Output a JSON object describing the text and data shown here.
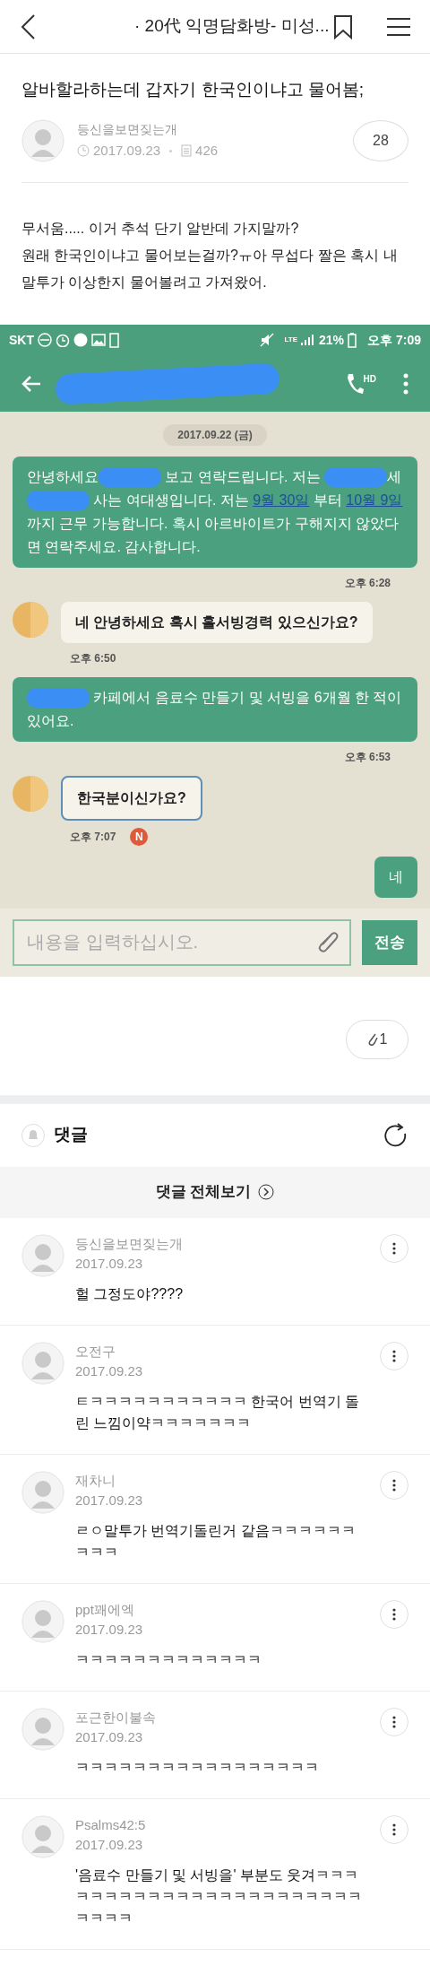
{
  "header": {
    "title": "· 20代 익명담화방- 미성..."
  },
  "post": {
    "title": "알바할라하는데 갑자기 한국인이냐고 물어봄;",
    "author": "등신을보면짖는개",
    "date": "2017.09.23",
    "views": "426",
    "comment_count": "28",
    "body": [
      "무서움..... 이거 추석 단기 알반데 가지말까?",
      "원래 한국인이냐고 물어보는걸까?ㅠ아 무섭다 짤은 혹시 내 말투가 이상한지 물어볼려고 가져왔어."
    ]
  },
  "screenshot": {
    "status_bar": {
      "carrier": "SKT",
      "network": "LTE",
      "battery": "21%",
      "time": "오후 7:09"
    },
    "call_badge": "HD",
    "date": "2017.09.22 (금)",
    "messages": [
      {
        "kind": "sent",
        "highlighted": false,
        "time": "오후 6:28",
        "parts": [
          {
            "kind": "text",
            "text": "안녕하세요"
          },
          {
            "kind": "redacted"
          },
          {
            "kind": "text",
            "text": " 보고  연락드립니다. 저는 "
          },
          {
            "kind": "redacted"
          },
          {
            "kind": "text",
            "text": "세"
          },
          {
            "kind": "redacted"
          },
          {
            "kind": "text",
            "text": " 사는 여대생입니다. 저는 "
          },
          {
            "kind": "link",
            "text": "9월 30일"
          },
          {
            "kind": "text",
            "text": " 부터 "
          },
          {
            "kind": "link",
            "text": "10월 9일"
          },
          {
            "kind": "text",
            "text": "까지 근무 가능합니다. 혹시 아르바이트가 구해지지 않았다면 연락주세요. 감사합니다."
          }
        ]
      },
      {
        "kind": "received",
        "highlighted": false,
        "time": "오후 6:50",
        "parts": [
          {
            "kind": "text",
            "text": "네 안녕하세요 혹시 홀서빙경력 있으신가요?"
          }
        ]
      },
      {
        "kind": "sent",
        "highlighted": false,
        "time": "오후 6:53",
        "parts": [
          {
            "kind": "redacted"
          },
          {
            "kind": "text",
            "text": " 카페에서 음료수 만들기 및 서빙을 6개월 한 적이 있어요."
          }
        ]
      },
      {
        "kind": "received",
        "highlighted": true,
        "time": "오후 7:07",
        "badge": "N",
        "parts": [
          {
            "kind": "text",
            "text": "한국분이신가요?"
          }
        ]
      },
      {
        "kind": "sent",
        "highlighted": false,
        "parts": [
          {
            "kind": "text",
            "text": "네"
          }
        ]
      }
    ],
    "input": {
      "placeholder": "내용을 입력하십시오."
    },
    "send": "전송"
  },
  "attachments": {
    "count": "1"
  },
  "comments_section": {
    "title": "댓글",
    "view_all": "댓글 전체보기"
  },
  "comments": [
    {
      "author": "등신을보면짖는개",
      "date": "2017.09.23",
      "text": "헐 그정도야????"
    },
    {
      "author": "오전구",
      "date": "2017.09.23",
      "text": "ㅌㅋㅋㅋㅋㅋㅋㅋㅋㅋㅋㅋ 한국어 번역기 돌린 느낌이약ㅋㅋㅋㅋㅋㅋㅋ"
    },
    {
      "author": "재차니",
      "date": "2017.09.23",
      "text": "ㄹㅇ말투가 번역기돌린거 같음ㅋㅋㅋㅋㅋㅋㅋㅋㅋ"
    },
    {
      "author": "ppt꽤에엑",
      "date": "2017.09.23",
      "text": "ㅋㅋㅋㅋㅋㅋㅋㅋㅋㅋㅋㅋㅋ"
    },
    {
      "author": "포근한이불속",
      "date": "2017.09.23",
      "text": "ㅋㅋㅋㅋㅋㅋㅋㅋㅋㅋㅋㅋㅋㅋㅋㅋㅋ"
    },
    {
      "author": "Psalms42:5",
      "date": "2017.09.23",
      "text": "'음료수 만들기 및 서빙을' 부분도 웃겨ㅋㅋㅋㅋㅋㅋㅋㅋㅋㅋㅋㅋㅋㅋㅋㅋㅋㅋㅋㅋㅋㅋㅋㅋㅋㅋㅋ"
    }
  ]
}
